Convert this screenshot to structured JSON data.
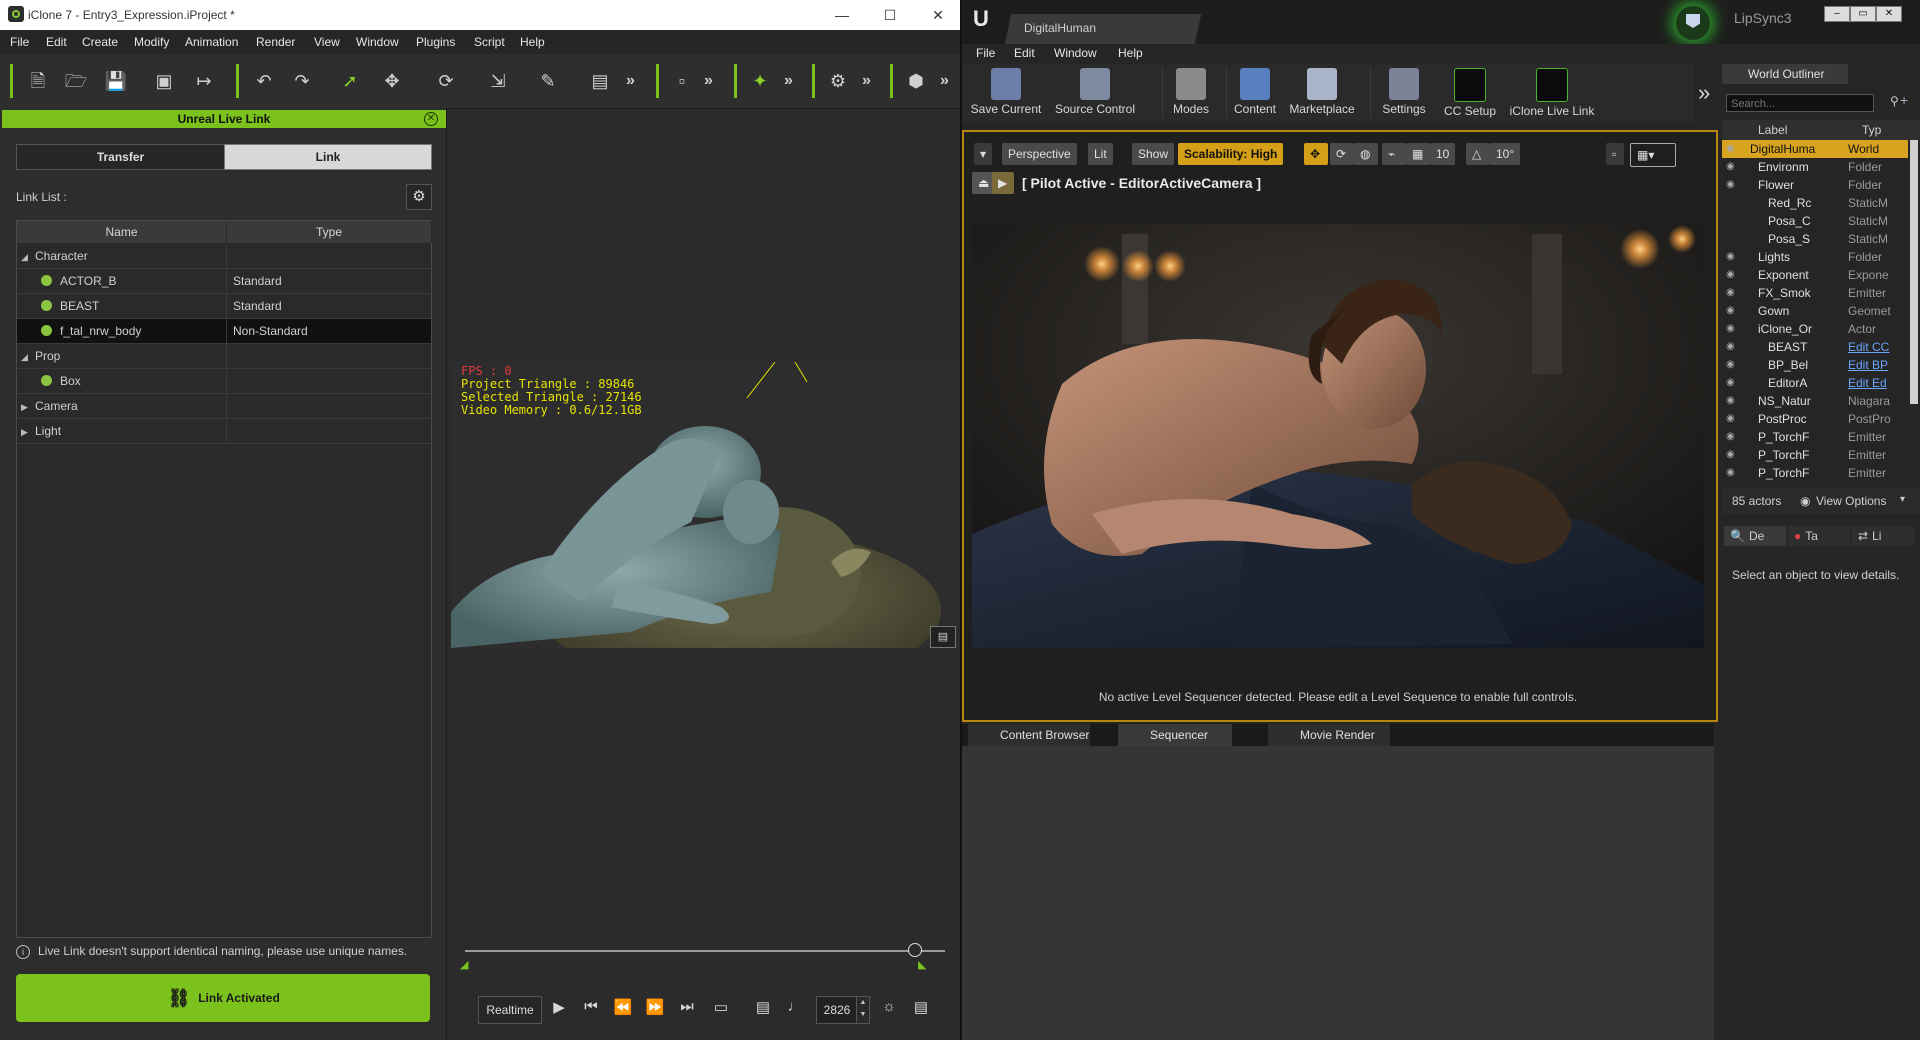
{
  "iclone": {
    "title": "iClone 7 - Entry3_Expression.iProject *",
    "window_controls": {
      "minimize": "—",
      "maximize": "☐",
      "close": "✕"
    },
    "menu": [
      "File",
      "Edit",
      "Create",
      "Modify",
      "Animation",
      "Render",
      "View",
      "Window",
      "Plugins",
      "Script",
      "Help"
    ],
    "panel": {
      "title": "Unreal Live Link",
      "tabs": {
        "transfer": "Transfer",
        "link": "Link"
      },
      "link_list_label": "Link List :",
      "columns": {
        "name": "Name",
        "type": "Type"
      },
      "rows": [
        {
          "name": "Character",
          "type": "",
          "kind": "group"
        },
        {
          "name": "ACTOR_B",
          "type": "Standard",
          "kind": "item"
        },
        {
          "name": "BEAST",
          "type": "Standard",
          "kind": "item"
        },
        {
          "name": "f_tal_nrw_body",
          "type": "Non-Standard",
          "kind": "item",
          "selected": true
        },
        {
          "name": "Prop",
          "type": "",
          "kind": "group"
        },
        {
          "name": "Box",
          "type": "",
          "kind": "item"
        },
        {
          "name": "Camera",
          "type": "",
          "kind": "group-collapsed"
        },
        {
          "name": "Light",
          "type": "",
          "kind": "group-collapsed"
        }
      ],
      "note": "Live Link doesn't support identical naming, please use unique names.",
      "button": "Link Activated"
    },
    "viewport": {
      "fps": "FPS : 0",
      "triangles": "Project Triangle : 89846",
      "selected": "Selected Triangle : 27146",
      "memory": "Video Memory : 0.6/12.1GB"
    },
    "playback": {
      "mode": "Realtime",
      "frame": "2826"
    }
  },
  "unreal": {
    "tab_title": "DigitalHuman",
    "project": "LipSync3",
    "menu": [
      "File",
      "Edit",
      "Window",
      "Help"
    ],
    "toolbar": [
      "Save Current",
      "Source Control",
      "Modes",
      "Content",
      "Marketplace",
      "Settings",
      "CC Setup",
      "iClone Live Link"
    ],
    "viewport": {
      "perspective": "Perspective",
      "lit": "Lit",
      "show": "Show",
      "scalability": "Scalability: High",
      "grid_value": "10",
      "angle_value": "10°",
      "pilot": "[ Pilot Active - EditorActiveCamera ]",
      "message": "No active Level Sequencer detected. Please edit a Level Sequence to enable full controls."
    },
    "bottom_tabs": [
      "Content Browser",
      "Sequencer",
      "Movie Render Que"
    ],
    "outliner": {
      "title": "World Outliner",
      "search_placeholder": "Search...",
      "col_label": "Label",
      "col_type": "Typ",
      "rows": [
        {
          "name": "DigitalHuma",
          "type": "World",
          "selected": true
        },
        {
          "name": "Environm",
          "type": "Folder"
        },
        {
          "name": "Flower",
          "type": "Folder"
        },
        {
          "name": "Red_Rc",
          "type": "StaticM"
        },
        {
          "name": "Posa_C",
          "type": "StaticM"
        },
        {
          "name": "Posa_S",
          "type": "StaticM"
        },
        {
          "name": "Lights",
          "type": "Folder"
        },
        {
          "name": "Exponent",
          "type": "Expone"
        },
        {
          "name": "FX_Smok",
          "type": "Emitter"
        },
        {
          "name": "Gown",
          "type": "Geomet"
        },
        {
          "name": "iClone_Or",
          "type": "Actor"
        },
        {
          "name": "BEAST",
          "type": "Edit CC",
          "link": true
        },
        {
          "name": "BP_Bel",
          "type": "Edit BP",
          "link": true
        },
        {
          "name": "EditorA",
          "type": "Edit Ed",
          "link": true
        },
        {
          "name": "NS_Natur",
          "type": "Niagara"
        },
        {
          "name": "PostProc",
          "type": "PostPro"
        },
        {
          "name": "P_TorchF",
          "type": "Emitter"
        },
        {
          "name": "P_TorchF",
          "type": "Emitter"
        },
        {
          "name": "P_TorchF",
          "type": "Emitter"
        }
      ],
      "actor_count": "85 actors",
      "view_options": "View Options"
    },
    "details": {
      "tabs": [
        "De",
        "Ta",
        "Li"
      ],
      "message": "Select an object to view details."
    }
  },
  "colors": {
    "iclone_accent": "#7cc21c",
    "ue_selection": "#d8a420",
    "ue_viewport_border": "#b8860b"
  }
}
